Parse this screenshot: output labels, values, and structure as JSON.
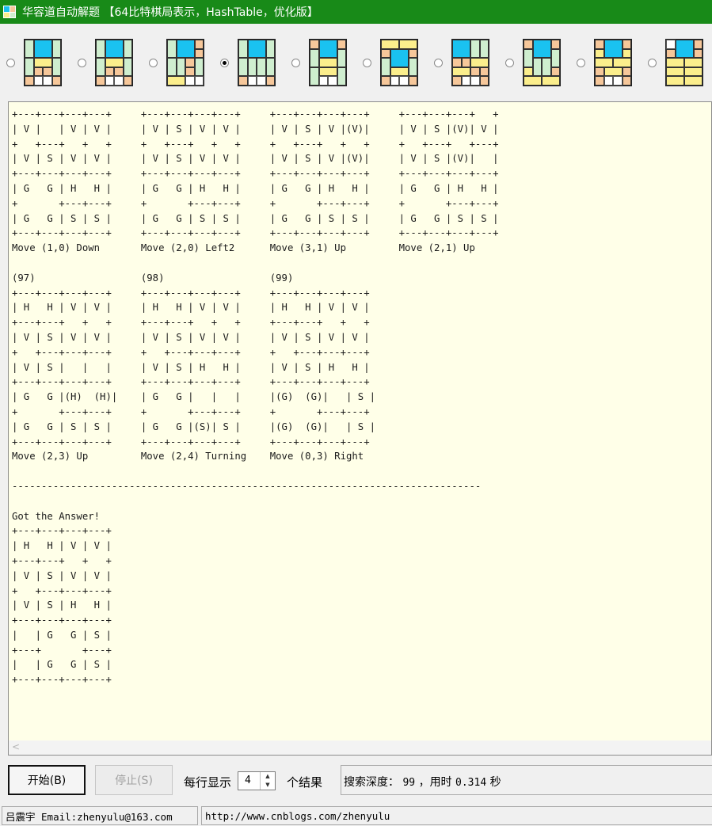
{
  "window": {
    "title": "华容道自动解题 【64比特棋局表示，HashTable，优化版】"
  },
  "colors": {
    "titlebar": "#188a18",
    "cao_cao": "#1ac2f0",
    "vertical_general": "#cfeecf",
    "horizontal_general": "#fbee8c",
    "soldier": "#f6c79a"
  },
  "presets": {
    "selected_index": 3,
    "items": [
      {
        "name": "layout-1"
      },
      {
        "name": "layout-2"
      },
      {
        "name": "layout-3"
      },
      {
        "name": "layout-4"
      },
      {
        "name": "layout-5"
      },
      {
        "name": "layout-6"
      },
      {
        "name": "layout-7"
      },
      {
        "name": "layout-8"
      },
      {
        "name": "layout-9"
      },
      {
        "name": "layout-10"
      }
    ]
  },
  "output": {
    "text": "+---+---+---+---+     +---+---+---+---+     +---+---+---+---+     +---+---+---+   +\n| V |   | V | V |     | V | S | V | V |     | V | S | V |(V)|     | V | S |(V)| V |\n+   +---+   +   +     +   +---+   +   +     +   +---+   +   +     +   +---+   +---+\n| V | S | V | V |     | V | S | V | V |     | V | S | V |(V)|     | V | S |(V)|   |\n+---+---+---+---+     +---+---+---+---+     +---+---+---+---+     +---+---+---+---+\n| G   G | H   H |     | G   G | H   H |     | G   G | H   H |     | G   G | H   H |\n+       +---+---+     +       +---+---+     +       +---+---+     +       +---+---+\n| G   G | S | S |     | G   G | S | S |     | G   G | S | S |     | G   G | S | S |\n+---+---+---+---+     +---+---+---+---+     +---+---+---+---+     +---+---+---+---+\nMove (1,0) Down       Move (2,0) Left2      Move (3,1) Up         Move (2,1) Up\n\n(97)                  (98)                  (99)\n+---+---+---+---+     +---+---+---+---+     +---+---+---+---+\n| H   H | V | V |     | H   H | V | V |     | H   H | V | V |\n+---+---+   +   +     +---+---+   +   +     +---+---+   +   +\n| V | S | V | V |     | V | S | V | V |     | V | S | V | V |\n+   +---+---+---+     +   +---+---+---+     +   +---+---+---+\n| V | S |   |   |     | V | S | H   H |     | V | S | H   H |\n+---+---+---+---+     +---+---+---+---+     +---+---+---+---+\n| G   G |(H)  (H)|    | G   G |   |   |     |(G)  (G)|   | S |\n+       +---+---+     +       +---+---+     +       +---+---+\n| G   G | S | S |     | G   G |(S)| S |     |(G)  (G)|   | S |\n+---+---+---+---+     +---+---+---+---+     +---+---+---+---+\nMove (2,3) Up         Move (2,4) Turning    Move (0,3) Right\n\n--------------------------------------------------------------------------------\n\nGot the Answer!\n+---+---+---+---+\n| H   H | V | V |\n+---+---+   +   +\n| V | S | V | V |\n+   +---+---+---+\n| V | S | H   H |\n+---+---+---+---+\n|   | G   G | S |\n+---+       +---+\n|   | G   G | S |\n+---+---+---+---+",
    "scroll_left_glyph": "<"
  },
  "controls": {
    "start_label": "开始(B)",
    "stop_label": "停止(S)",
    "per_row_label": "每行显示",
    "per_row_value": "4",
    "results_label": "个结果",
    "status_prefix": "搜索深度：",
    "depth_value": "99",
    "status_sep": "，",
    "time_label": "用时",
    "time_value": "0.314",
    "time_unit": "秒"
  },
  "statusbar": {
    "author": "吕震宇 Email:zhenyulu@163.com",
    "url": "http://www.cnblogs.com/zhenyulu"
  }
}
